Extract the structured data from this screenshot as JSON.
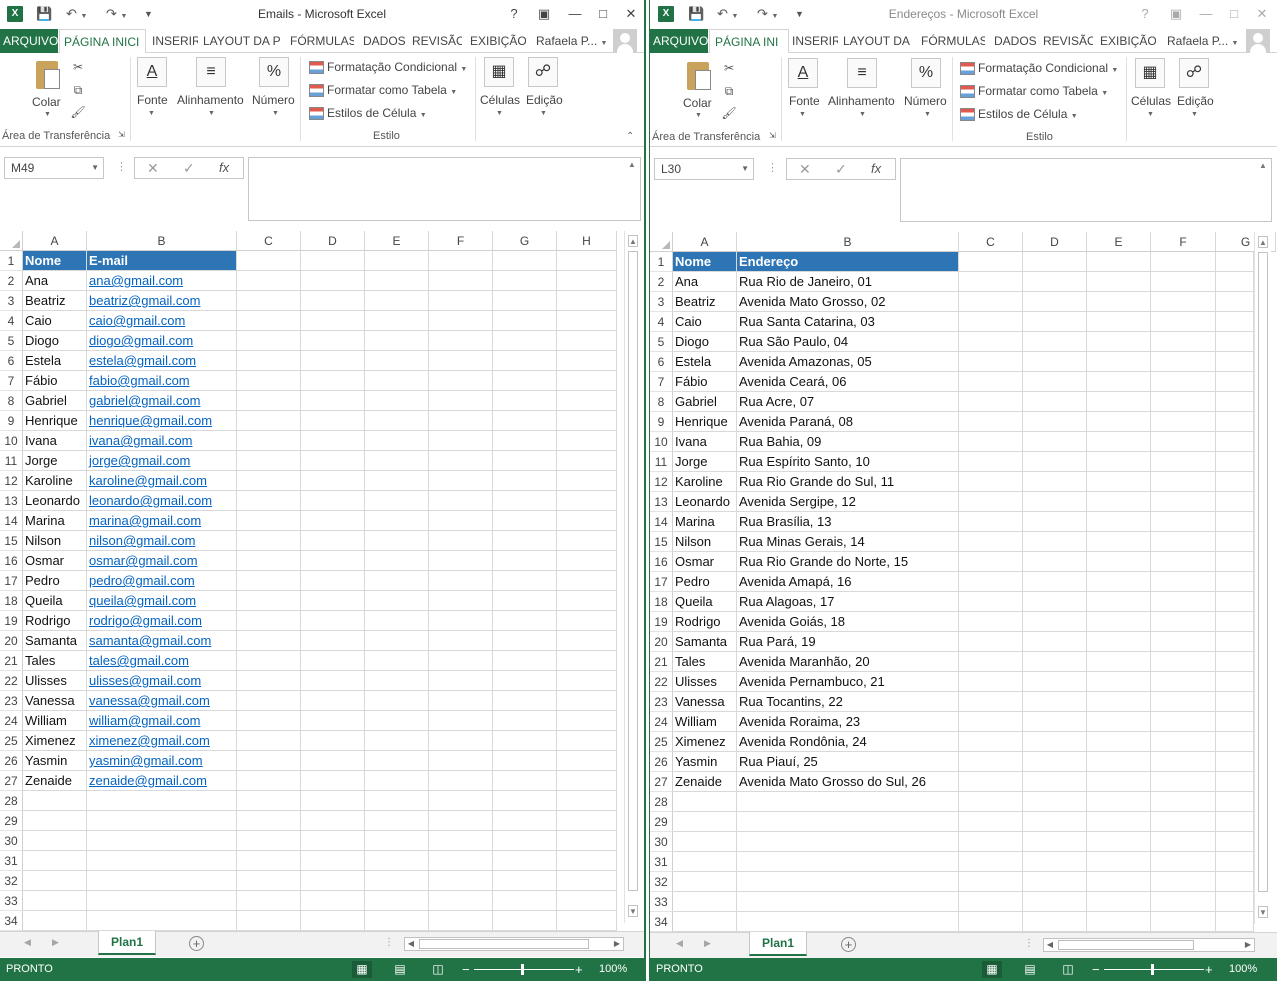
{
  "windows": [
    {
      "title": "Emails - Microsoft Excel",
      "tabs": [
        "ARQUIVO",
        "PÁGINA INICI",
        "INSERIR",
        "LAYOUT DA P",
        "FÓRMULAS",
        "DADOS",
        "REVISÃO",
        "EXIBIÇÃO"
      ],
      "user": "Rafaela P...",
      "ribbon": {
        "paste": "Colar",
        "clipboard_group": "Área de Transferência",
        "font": "Fonte",
        "alignment": "Alinhamento",
        "number": "Número",
        "conditional_formatting": "Formatação Condicional",
        "format_as_table": "Formatar como Tabela",
        "cell_styles": "Estilos de Célula",
        "styles_group": "Estilo",
        "cells": "Células",
        "editing": "Edição"
      },
      "name_box": "M49",
      "formula": "",
      "columns": [
        "A",
        "B",
        "C",
        "D",
        "E",
        "F",
        "G",
        "H"
      ],
      "header_row": [
        "Nome",
        "E-mail"
      ],
      "rows": [
        [
          "Ana",
          "ana@gmail.com"
        ],
        [
          "Beatriz",
          "beatriz@gmail.com"
        ],
        [
          "Caio",
          "caio@gmail.com"
        ],
        [
          "Diogo",
          "diogo@gmail.com"
        ],
        [
          "Estela",
          "estela@gmail.com"
        ],
        [
          "Fábio",
          "fabio@gmail.com"
        ],
        [
          "Gabriel",
          "gabriel@gmail.com"
        ],
        [
          "Henrique",
          "henrique@gmail.com"
        ],
        [
          "Ivana",
          "ivana@gmail.com"
        ],
        [
          "Jorge",
          "jorge@gmail.com"
        ],
        [
          "Karoline",
          "karoline@gmail.com"
        ],
        [
          "Leonardo",
          "leonardo@gmail.com"
        ],
        [
          "Marina",
          "marina@gmail.com"
        ],
        [
          "Nilson",
          "nilson@gmail.com"
        ],
        [
          "Osmar",
          "osmar@gmail.com"
        ],
        [
          "Pedro",
          "pedro@gmail.com"
        ],
        [
          "Queila",
          "queila@gmail.com"
        ],
        [
          "Rodrigo",
          "rodrigo@gmail.com"
        ],
        [
          "Samanta",
          "samanta@gmail.com"
        ],
        [
          "Tales",
          "tales@gmail.com"
        ],
        [
          "Ulisses",
          "ulisses@gmail.com"
        ],
        [
          "Vanessa",
          "vanessa@gmail.com"
        ],
        [
          "William",
          "william@gmail.com"
        ],
        [
          "Ximenez",
          "ximenez@gmail.com"
        ],
        [
          "Yasmin",
          "yasmin@gmail.com"
        ],
        [
          "Zenaide",
          "zenaide@gmail.com"
        ]
      ],
      "row_numbers": [
        "1",
        "2",
        "3",
        "4",
        "5",
        "6",
        "7",
        "8",
        "9",
        "10",
        "11",
        "12",
        "13",
        "14",
        "15",
        "16",
        "17",
        "18",
        "19",
        "20",
        "21",
        "22",
        "23",
        "24",
        "25",
        "26",
        "27",
        "28",
        "29",
        "30",
        "31",
        "32",
        "33",
        "34"
      ],
      "sheet_tab": "Plan1",
      "status": "PRONTO",
      "zoom": "100%"
    },
    {
      "title": "Endereços - Microsoft Excel",
      "tabs": [
        "ARQUIVO",
        "PÁGINA INI",
        "INSERIR",
        "LAYOUT DA",
        "FÓRMULAS",
        "DADOS",
        "REVISÃO",
        "EXIBIÇÃO"
      ],
      "user": "Rafaela P...",
      "ribbon": {
        "paste": "Colar",
        "clipboard_group": "Área de Transferência",
        "font": "Fonte",
        "alignment": "Alinhamento",
        "number": "Número",
        "conditional_formatting": "Formatação Condicional",
        "format_as_table": "Formatar como Tabela",
        "cell_styles": "Estilos de Célula",
        "styles_group": "Estilo",
        "cells": "Células",
        "editing": "Edição"
      },
      "name_box": "L30",
      "formula": "",
      "columns": [
        "A",
        "B",
        "C",
        "D",
        "E",
        "F",
        "G"
      ],
      "header_row": [
        "Nome",
        "Endereço"
      ],
      "rows": [
        [
          "Ana",
          "Rua Rio de Janeiro, 01"
        ],
        [
          "Beatriz",
          "Avenida Mato Grosso, 02"
        ],
        [
          "Caio",
          "Rua Santa Catarina, 03"
        ],
        [
          "Diogo",
          "Rua São Paulo, 04"
        ],
        [
          "Estela",
          "Avenida Amazonas, 05"
        ],
        [
          "Fábio",
          "Avenida Ceará, 06"
        ],
        [
          "Gabriel",
          "Rua Acre, 07"
        ],
        [
          "Henrique",
          "Avenida Paraná, 08"
        ],
        [
          "Ivana",
          "Rua Bahia, 09"
        ],
        [
          "Jorge",
          "Rua Espírito Santo, 10"
        ],
        [
          "Karoline",
          "Rua Rio Grande do Sul, 11"
        ],
        [
          "Leonardo",
          "Avenida Sergipe, 12"
        ],
        [
          "Marina",
          "Rua Brasília, 13"
        ],
        [
          "Nilson",
          "Rua Minas Gerais, 14"
        ],
        [
          "Osmar",
          "Rua Rio Grande do Norte, 15"
        ],
        [
          "Pedro",
          "Avenida Amapá, 16"
        ],
        [
          "Queila",
          "Rua Alagoas, 17"
        ],
        [
          "Rodrigo",
          "Avenida Goiás, 18"
        ],
        [
          "Samanta",
          "Rua Pará, 19"
        ],
        [
          "Tales",
          "Avenida Maranhão, 20"
        ],
        [
          "Ulisses",
          "Avenida Pernambuco, 21"
        ],
        [
          "Vanessa",
          "Rua Tocantins, 22"
        ],
        [
          "William",
          "Avenida Roraima, 23"
        ],
        [
          "Ximenez",
          "Avenida Rondônia, 24"
        ],
        [
          "Yasmin",
          "Rua Piauí, 25"
        ],
        [
          "Zenaide",
          "Avenida Mato Grosso do Sul, 26"
        ]
      ],
      "row_numbers": [
        "1",
        "2",
        "3",
        "4",
        "5",
        "6",
        "7",
        "8",
        "9",
        "10",
        "11",
        "12",
        "13",
        "14",
        "15",
        "16",
        "17",
        "18",
        "19",
        "20",
        "21",
        "22",
        "23",
        "24",
        "25",
        "26",
        "27",
        "28",
        "29",
        "30",
        "31",
        "32",
        "33",
        "34"
      ],
      "sheet_tab": "Plan1",
      "status": "PRONTO",
      "zoom": "100%"
    }
  ],
  "colors": {
    "excel_green": "#217346",
    "table_header_blue": "#2e75b6",
    "hyperlink_blue": "#0563c1"
  },
  "icons": {
    "app": "excel-logo-icon",
    "save": "save-icon",
    "undo": "undo-icon",
    "redo": "redo-icon",
    "customize_qat": "customize-qat-icon",
    "help": "help-icon",
    "restore_ribbon": "ribbon-display-icon",
    "minimize": "minimize-icon",
    "maximize": "maximize-icon",
    "close": "close-icon"
  }
}
